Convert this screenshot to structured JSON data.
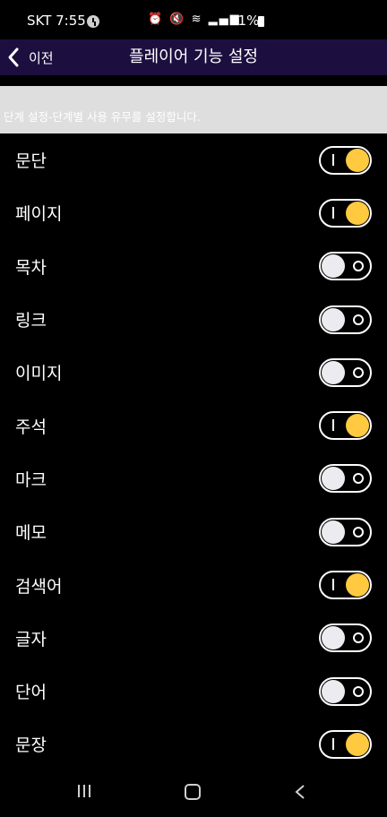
{
  "status_bar": {
    "carrier_time": "SKT 7:55",
    "battery_percent": "71%"
  },
  "header": {
    "back_label": "이전",
    "title": "플레이어 기능 설정"
  },
  "description": "단계 설정-단계별 사용 유무를 설정합니다.",
  "settings": [
    {
      "label": "문단",
      "enabled": true
    },
    {
      "label": "페이지",
      "enabled": true
    },
    {
      "label": "목차",
      "enabled": false
    },
    {
      "label": "링크",
      "enabled": false
    },
    {
      "label": "이미지",
      "enabled": false
    },
    {
      "label": "주석",
      "enabled": true
    },
    {
      "label": "마크",
      "enabled": false
    },
    {
      "label": "메모",
      "enabled": false
    },
    {
      "label": "검색어",
      "enabled": true
    },
    {
      "label": "글자",
      "enabled": false
    },
    {
      "label": "단어",
      "enabled": false
    },
    {
      "label": "문장",
      "enabled": true
    }
  ],
  "colors": {
    "header_bg": "#1c0f3f",
    "toggle_on": "#ffc940",
    "toggle_off": "#ececf0"
  },
  "icons": {
    "back": "chevron-left-icon",
    "nav_recents": "recents-icon",
    "nav_home": "home-icon",
    "nav_back": "back-icon"
  }
}
